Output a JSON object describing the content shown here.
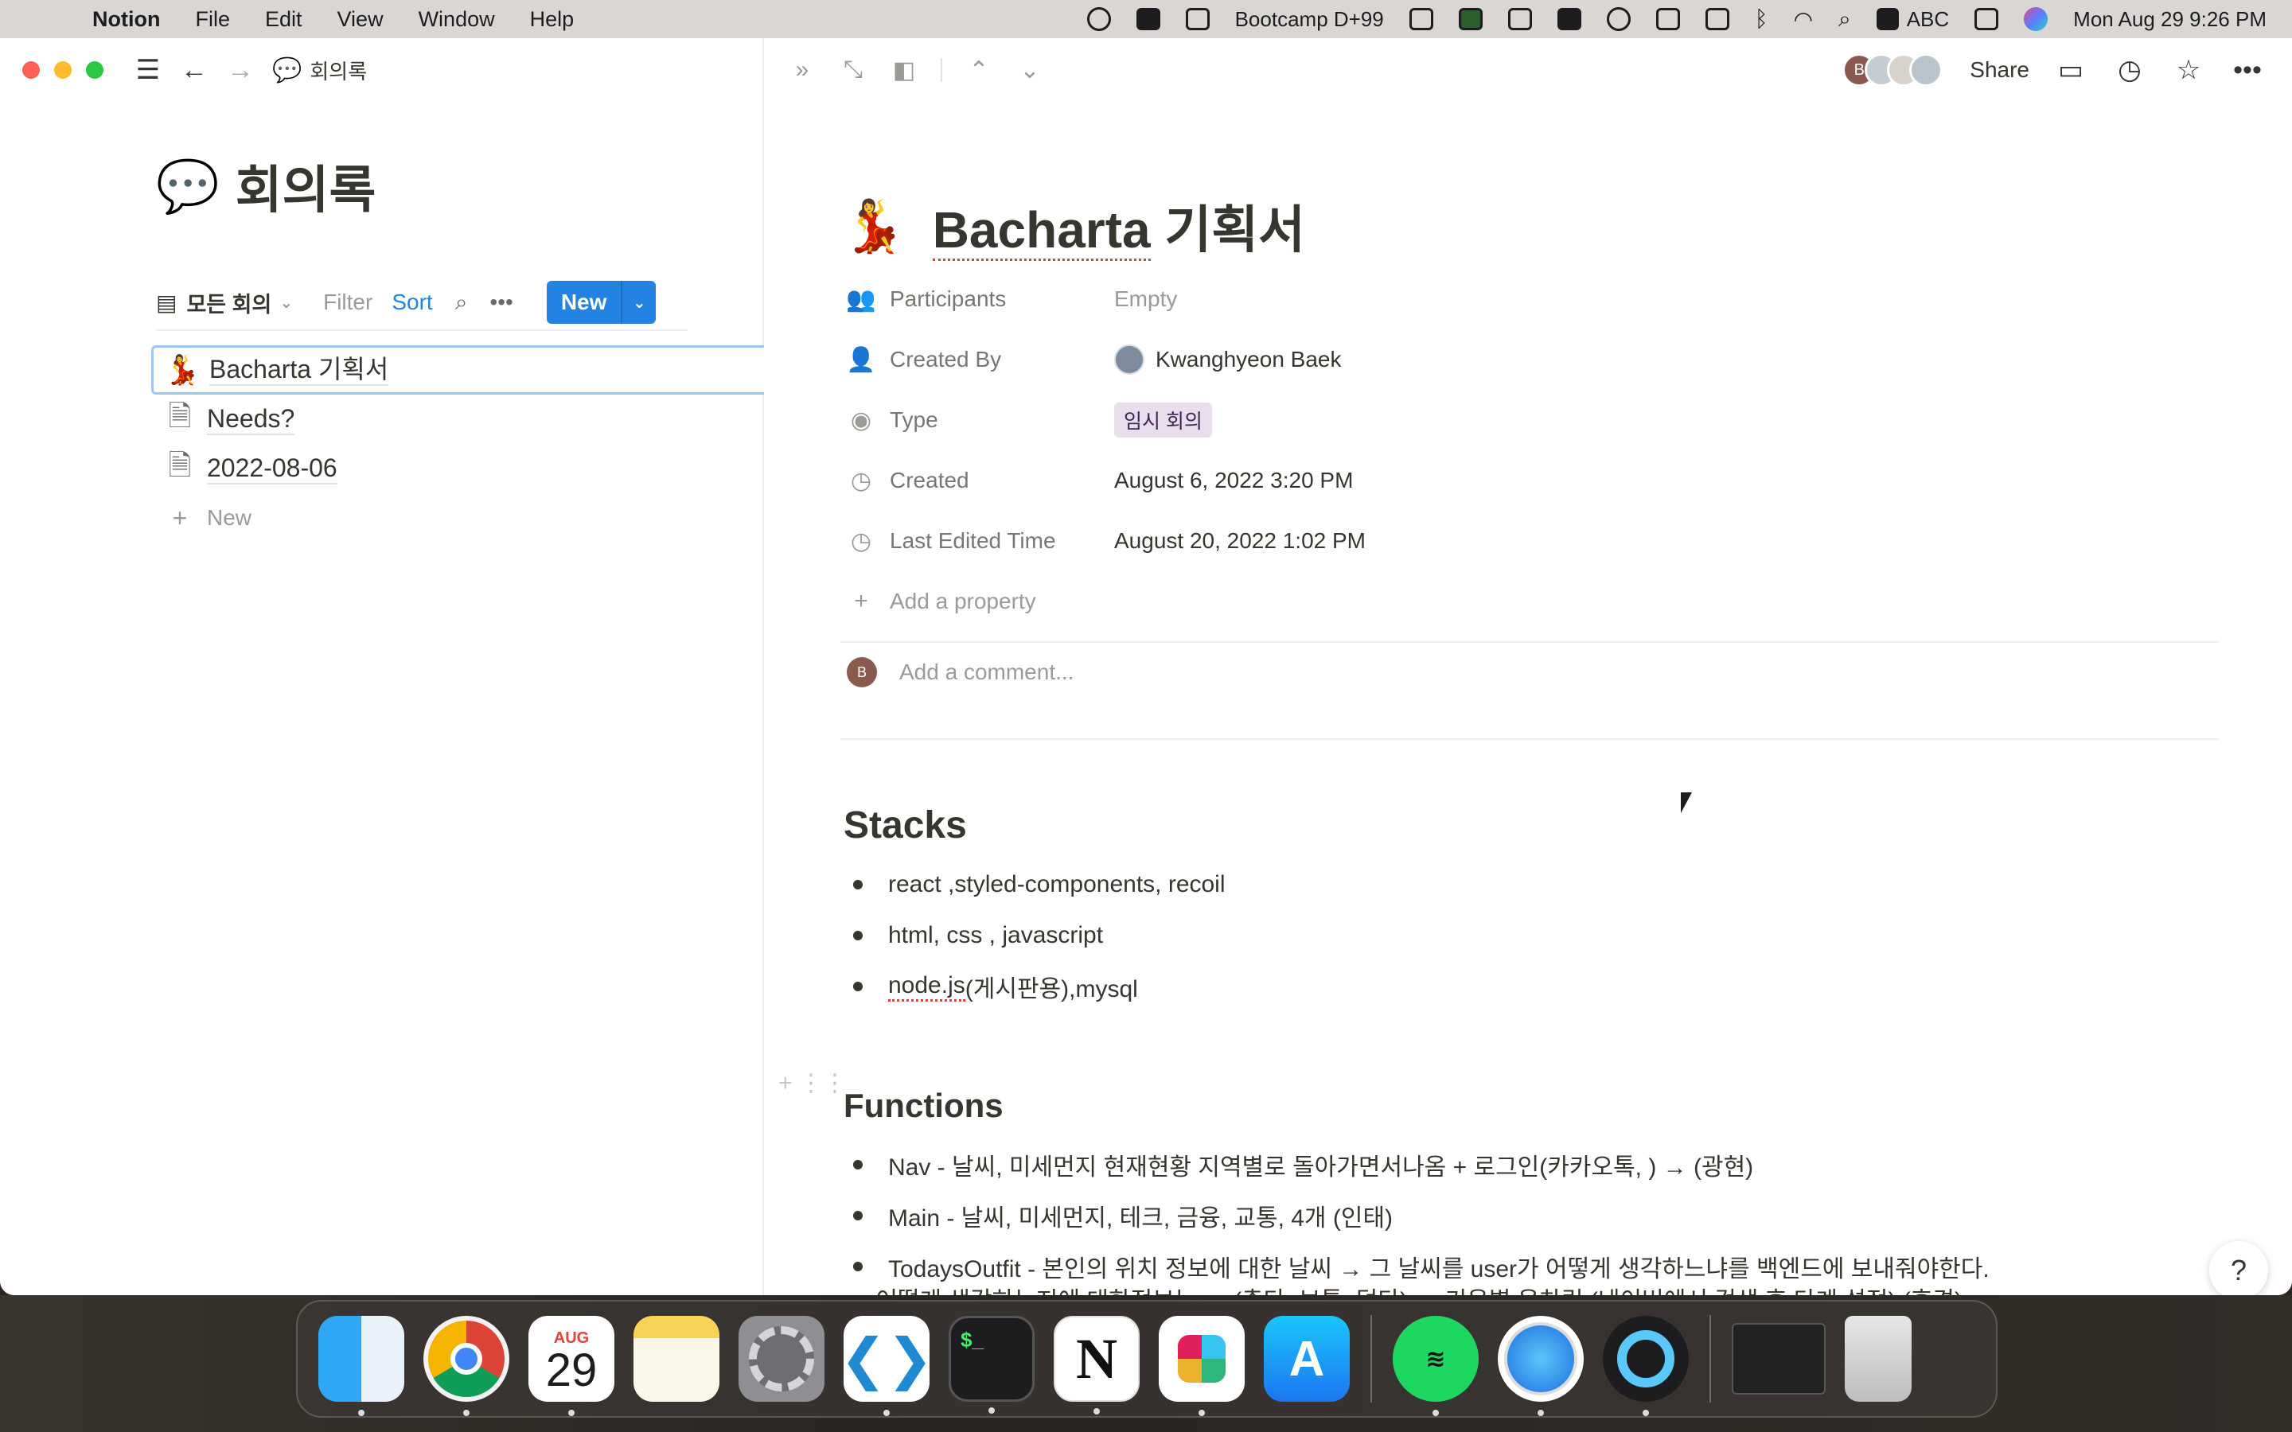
{
  "menubar": {
    "app_name": "Notion",
    "menus": [
      "File",
      "Edit",
      "View",
      "Window",
      "Help"
    ],
    "bootcamp": "Bootcamp D+99",
    "input_method": "ABC",
    "datetime": "Mon Aug 29  9:26 PM"
  },
  "left": {
    "breadcrumb": "회의록",
    "db_title": "회의록",
    "view_name": "모든 회의",
    "filter_label": "Filter",
    "sort_label": "Sort",
    "new_label": "New",
    "rows": [
      {
        "title": "Bacharta 기획서"
      },
      {
        "title": "Needs?"
      },
      {
        "title": "2022-08-06"
      }
    ],
    "add_new_label": "New"
  },
  "right": {
    "share_label": "Share",
    "avatar_initial": "B",
    "title_word": "Bacharta",
    "title_rest": " 기획서",
    "properties": {
      "participants_label": "Participants",
      "participants_value": "Empty",
      "created_by_label": "Created By",
      "created_by_value": "Kwanghyeon Baek",
      "type_label": "Type",
      "type_value": "임시 회의",
      "created_label": "Created",
      "created_value": "August 6, 2022 3:20 PM",
      "edited_label": "Last Edited Time",
      "edited_value": "August 20, 2022 1:02 PM",
      "add_property": "Add a property"
    },
    "comment_initial": "B",
    "comment_placeholder": "Add a comment...",
    "stacks_heading": "Stacks",
    "stacks": {
      "item1": "react ,styled-components, recoil",
      "item2": "html, css , javascript",
      "item3_sq": "node.js",
      "item3_rest": " (게시판용),mysql"
    },
    "functions_heading": "Functions",
    "functions": [
      "Nav - 날씨, 미세먼지 현재현황 지역별로 돌아가면서나옴 + 로그인(카카오톡, ) → (광현)",
      "Main - 날씨, 미세먼지, 테크, 금융, 교통, 4개 (인태)",
      "TodaysOutfit - 본인의 위치 정보에 대한 날씨 → 그 날씨를 user가 어떻게 생각하느냐를 백엔드에 보내줘야한다."
    ],
    "paragraph": "→ 어떻게 생각하는지에 대한정보는 → (춥다, 보통, 덥다) → 기온별 옷차림 (네이버에서 검색 후 단계 설정) (후경)",
    "help_label": "?"
  },
  "dock": {
    "calendar_month": "AUG",
    "calendar_day": "29"
  }
}
